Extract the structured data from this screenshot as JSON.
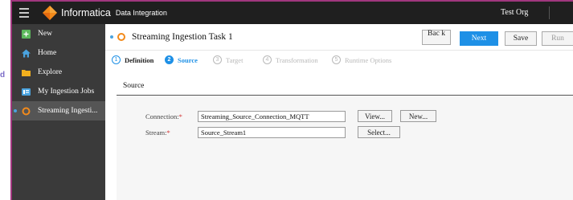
{
  "outside": {
    "letter": "d"
  },
  "topbar": {
    "brand": "Informatica",
    "product": "Data Integration",
    "org": "Test Org"
  },
  "sidebar": {
    "items": [
      {
        "label": "New",
        "icon": "plus-icon"
      },
      {
        "label": "Home",
        "icon": "home-icon"
      },
      {
        "label": "Explore",
        "icon": "folder-icon"
      },
      {
        "label": "My Ingestion Jobs",
        "icon": "jobs-icon"
      },
      {
        "label": "Streaming Ingesti...",
        "icon": "streaming-ring-icon",
        "active": true
      }
    ]
  },
  "main": {
    "task_title": "Streaming Ingestion Task 1",
    "buttons": {
      "back": "Bac k",
      "next": "Next",
      "save": "Save",
      "run": "Run",
      "cut": "("
    },
    "steps": [
      {
        "num": "1",
        "label": "Definition",
        "state": "done"
      },
      {
        "num": "2",
        "label": "Source",
        "state": "current"
      },
      {
        "num": "3",
        "label": "Target",
        "state": "pending"
      },
      {
        "num": "4",
        "label": "Transformation",
        "state": "pending"
      },
      {
        "num": "5",
        "label": "Runtime Options",
        "state": "pending"
      }
    ],
    "section_title": "Source",
    "form": {
      "connection_label": "Connection:",
      "connection_value": "Streaming_Source_Connection_MQTT",
      "view_button": "View...",
      "new_button": "New...",
      "stream_label": "Stream:",
      "stream_value": "Source_Stream1",
      "select_button": "Select...",
      "required_mark": "*"
    }
  },
  "colors": {
    "topbar": "#1f1f1f",
    "sidebar": "#3a3a3a",
    "accent_blue": "#1e90e6",
    "accent_orange": "#f28a1b",
    "frame": "#a0377e"
  }
}
